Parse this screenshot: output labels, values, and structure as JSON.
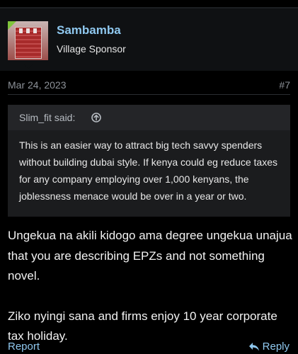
{
  "post": {
    "author": {
      "name": "Sambamba",
      "title": "Village Sponsor"
    },
    "date": "Mar 24, 2023",
    "post_number": "#7",
    "quote": {
      "author_label": "Slim_fit said:",
      "text": "This is an easier way to attract big tech savvy spenders without building dubai style. If kenya could eg reduce taxes for any company employing over 1,000 kenyans, the joblessness menace would be over in a year or two."
    },
    "body": {
      "paragraph1": "Ungekua na akili kidogo ama degree ungekua unajua that you are describing EPZs and not something novel.",
      "paragraph2": "Ziko nyingi sana and firms enjoy 10 year corporate tax holiday."
    },
    "actions": {
      "report": "Report",
      "reply": "Reply"
    }
  },
  "colors": {
    "link": "#8fc8ef",
    "header_bg": "#0f1113",
    "quote_bg": "#1b1c1e",
    "avatar_badge": "#7fc43c"
  },
  "icons": {
    "quote_jump": "arrow-up-circle-icon",
    "reply": "reply-arrow-icon"
  }
}
